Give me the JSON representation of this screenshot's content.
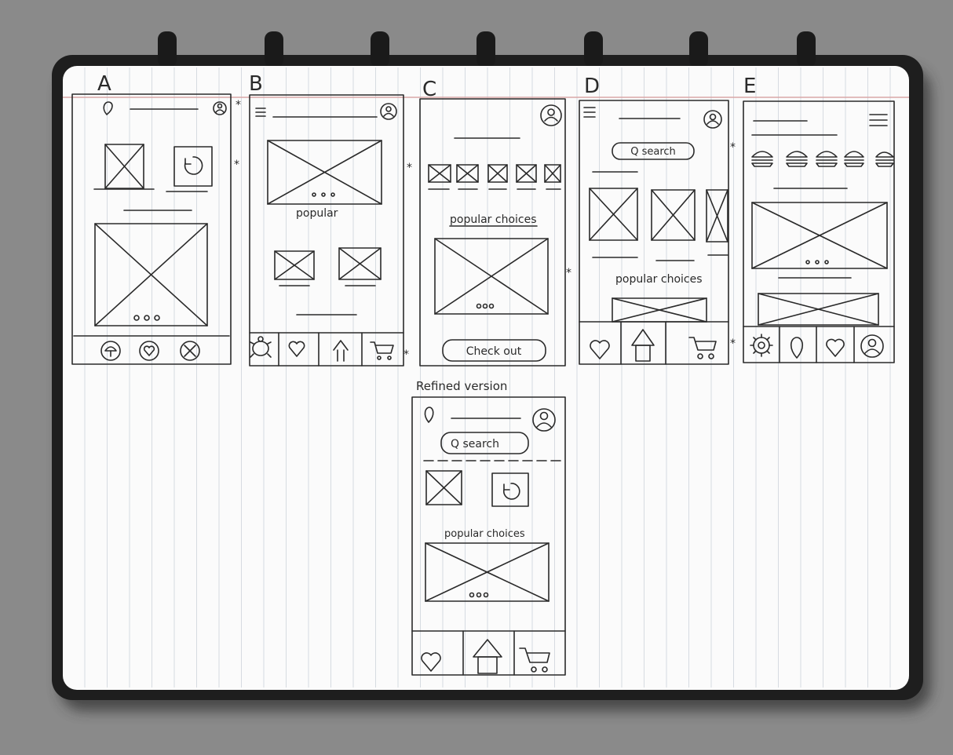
{
  "notebook": {
    "colors": {
      "background": "#8a8a8a",
      "frame": "#1e1e1e",
      "paper": "#fbfbfb",
      "ruling": "#d6dbe1",
      "margin_line": "#d9a7a7",
      "ink": "#2a2a2a"
    }
  },
  "wireframes": [
    {
      "letter": "A"
    },
    {
      "letter": "B",
      "caption": "popular"
    },
    {
      "letter": "C",
      "caption": "popular choices",
      "button_label": "Check out"
    },
    {
      "letter": "D",
      "search_label": "Q search",
      "caption": "popular choices"
    },
    {
      "letter": "E"
    }
  ],
  "refined": {
    "title": "Refined version",
    "search_label": "Q search",
    "caption": "popular choices"
  },
  "icons": [
    "pin-icon",
    "profile-icon",
    "refresh-icon",
    "hamburger-icon",
    "turtle-icon",
    "heart-icon",
    "home-icon",
    "cart-icon",
    "gear-icon",
    "close-icon",
    "mushroom-icon",
    "burger-icon"
  ]
}
